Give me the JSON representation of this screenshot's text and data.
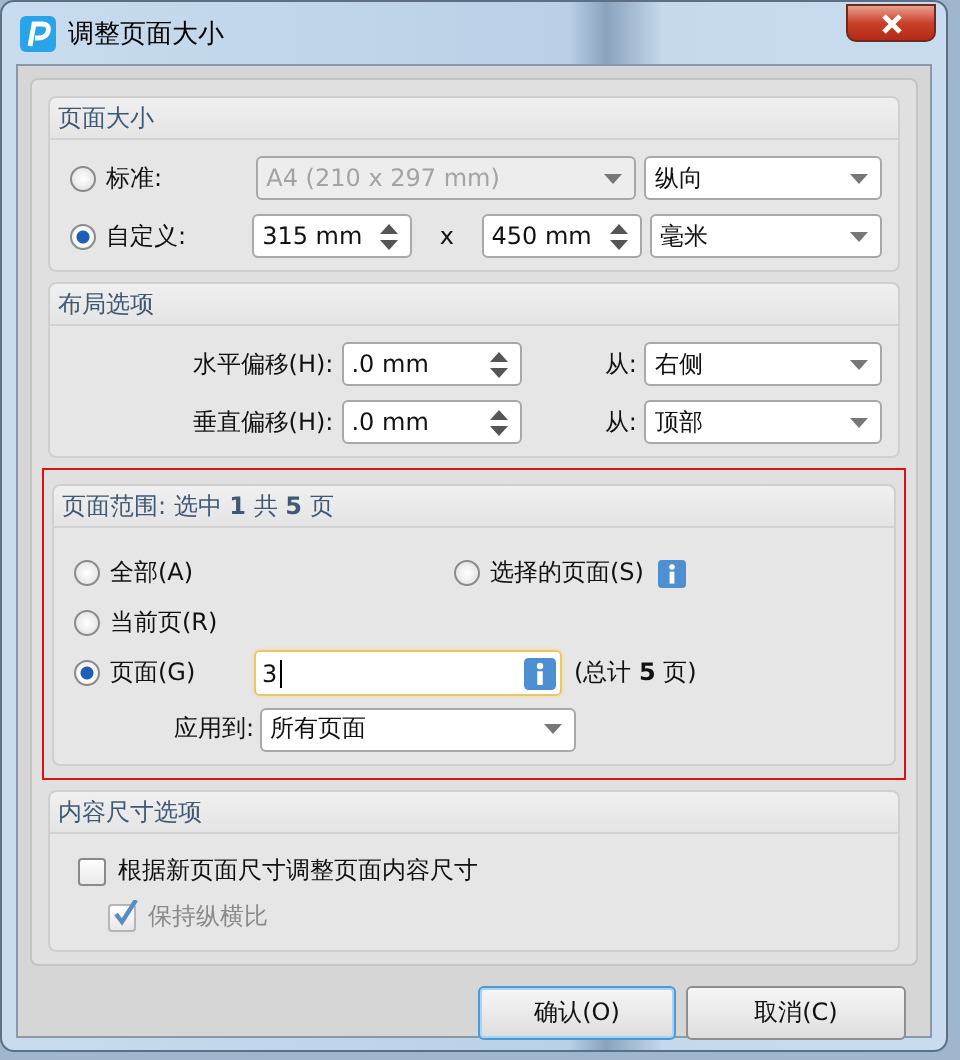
{
  "window": {
    "title": "调整页面大小"
  },
  "page_size": {
    "title": "页面大小",
    "options": [
      {
        "label": "标准:",
        "selected": false
      },
      {
        "label": "自定义:",
        "selected": true
      }
    ],
    "standard": {
      "value": "A4 (210 x 297 mm)",
      "disabled": true
    },
    "orientation": "纵向",
    "width": "315 mm",
    "times": "x",
    "height": "450 mm",
    "unit": "毫米"
  },
  "layout": {
    "title": "布局选项",
    "rows": [
      {
        "label": "水平偏移(H):",
        "value": ".0 mm",
        "from_label": "从:",
        "from": "右侧"
      },
      {
        "label": "垂直偏移(H):",
        "value": ".0 mm",
        "from_label": "从:",
        "from": "顶部"
      }
    ]
  },
  "page_range": {
    "title": "页面范围: 选中 **1** 共 **5** 页",
    "highlighted": true,
    "options": [
      {
        "label": "全部(A)",
        "selected": false
      },
      {
        "label": "选择的页面(S)",
        "selected": false,
        "info": true
      },
      {
        "label": "当前页(R)",
        "selected": false
      },
      {
        "label": "页面(G)",
        "selected": true
      }
    ],
    "pages_value": "3",
    "total": "(总计 **5** 页)",
    "apply_label": "应用到:",
    "apply_value": "所有页面"
  },
  "content_size": {
    "title": "内容尺寸选项",
    "options": [
      {
        "label": "根据新页面尺寸调整页面内容尺寸",
        "checked": false,
        "disabled": false
      },
      {
        "label": "保持纵横比",
        "checked": true,
        "disabled": true
      }
    ]
  },
  "buttons": [
    {
      "label": "确认(O)",
      "default": true
    },
    {
      "label": "取消(C)",
      "default": false
    }
  ]
}
